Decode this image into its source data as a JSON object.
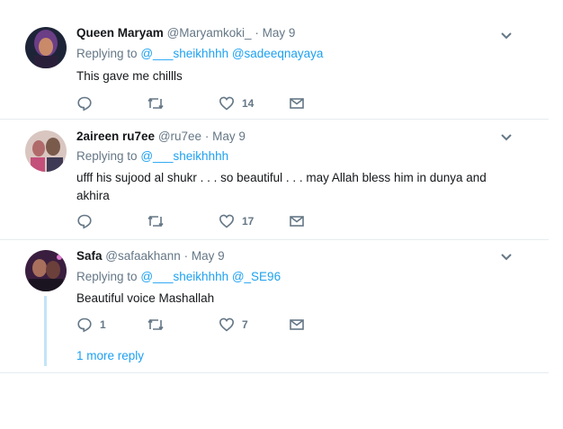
{
  "tweets": [
    {
      "name": "Queen Maryam",
      "handle": "@Maryamkoki_",
      "date": "May 9",
      "replying_label": "Replying to",
      "mentions": "@___sheikhhhh @sadeeqnayaya",
      "text": "This gave me chillls",
      "reply_count": "",
      "retweet_count": "",
      "like_count": "14"
    },
    {
      "name": "2aireen ru7ee",
      "handle": "@ru7ee",
      "date": "May 9",
      "replying_label": "Replying to",
      "mentions": "@___sheikhhhh",
      "text": "ufff his sujood al shukr . . . so beautiful . . . may Allah bless him in dunya and akhira",
      "reply_count": "",
      "retweet_count": "",
      "like_count": "17"
    },
    {
      "name": "Safa",
      "handle": "@safaakhann",
      "date": "May 9",
      "replying_label": "Replying to",
      "mentions": "@___sheikhhhh @_SE96",
      "text": "Beautiful voice Mashallah",
      "reply_count": "1",
      "retweet_count": "",
      "like_count": "7"
    }
  ],
  "more_reply": "1 more reply",
  "dot": "·",
  "icons": [
    "reply-icon",
    "retweet-icon",
    "like-icon",
    "message-icon",
    "chevron-down-icon"
  ],
  "colors": {
    "accent": "#1da1f2",
    "muted": "#657786",
    "text": "#14171a",
    "divider": "#e6ecf0"
  }
}
